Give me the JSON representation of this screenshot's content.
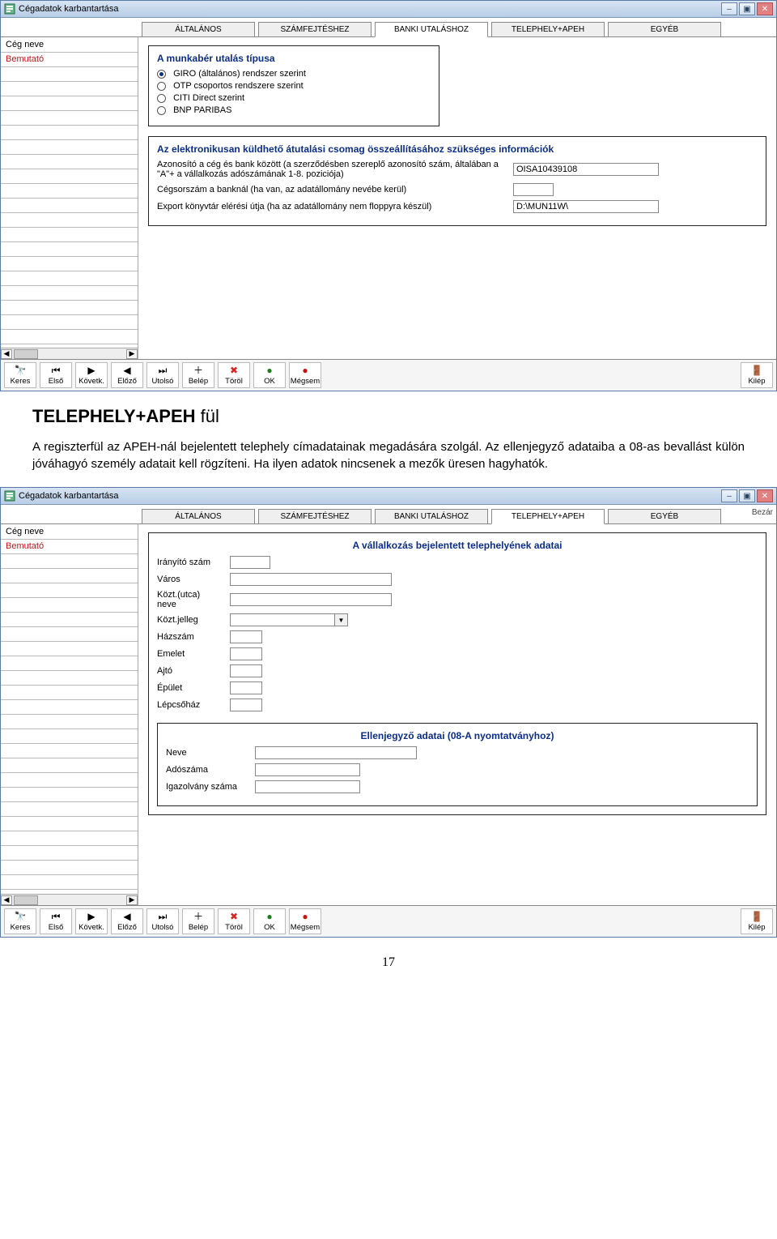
{
  "window_title": "Cégadatok karbantartása",
  "winbtns": {
    "min": "–",
    "max": "▣",
    "close": "✕"
  },
  "tabs": [
    "ÁLTALÁNOS",
    "SZÁMFEJTÉSHEZ",
    "BANKI UTALÁSHOZ",
    "TELEPHELY+APEH",
    "EGYÉB"
  ],
  "sidebar_header": "Cég neve",
  "sidebar_first_item": "Bemutató",
  "panel1_title": "A munkabér utalás típusa",
  "radio_options": [
    "GIRO (általános) rendszer szerint",
    "OTP csoportos rendszere szerint",
    "CITI Direct szerint",
    "BNP PARIBAS"
  ],
  "radio_selected_index": 0,
  "panel2_title": "Az elektronikusan küldhető átutalási csomag összeállításához szükséges információk",
  "panel2_row1_label": "Azonosító a cég és bank között (a szerződésben szereplő azonosító szám, általában a \"A\"+ a vállalkozás adószámának 1-8. poziciója)",
  "panel2_row1_value": "OISA10439108",
  "panel2_row2_label": "Cégsorszám a banknál (ha van, az adatállomány nevébe kerül)",
  "panel2_row2_value": "",
  "panel2_row3_label": "Export könyvtár elérési útja (ha az adatállomány  nem floppyra készül)",
  "panel2_row3_value": "D:\\MUN11W\\",
  "toolbar": {
    "keres": "Keres",
    "elso": "Első",
    "kovetk": "Követk.",
    "elozo": "Előző",
    "utolso": "Utolsó",
    "belep": "Belép",
    "torol": "Töröl",
    "ok": "OK",
    "megsem": "Mégsem",
    "kilep": "Kilép"
  },
  "heading_html_strong": "TELEPHELY+APEH",
  "heading_html_rest": " fül",
  "bodytext": "A regiszterfül az APEH-nál bejelentett telephely címadatainak megadására szolgál. Az ellenjegyző adataiba a 08-as bevallást külön jóváhagyó személy adatait kell rögzíteni. Ha ilyen adatok nincsenek a mezők üresen hagyhatók.",
  "panel3_title": "A vállalkozás bejelentett telephelyének adatai",
  "panel3_fields": {
    "iranyito": "Irányító szám",
    "varos": "Város",
    "kozt_neve": "Közt.(utca) neve",
    "kozt_jelleg": "Közt.jelleg",
    "hazszam": "Házszám",
    "emelet": "Emelet",
    "ajto": "Ajtó",
    "epulet": "Épület",
    "lepcsohaz": "Lépcsőház"
  },
  "panel4_title": "Ellenjegyző adatai (08-A nyomtatványhoz)",
  "panel4_fields": {
    "neve": "Neve",
    "adoszama": "Adószáma",
    "igazolvany": "Igazolvány száma"
  },
  "bezar_hint": "Bezár",
  "pagenum": "17"
}
